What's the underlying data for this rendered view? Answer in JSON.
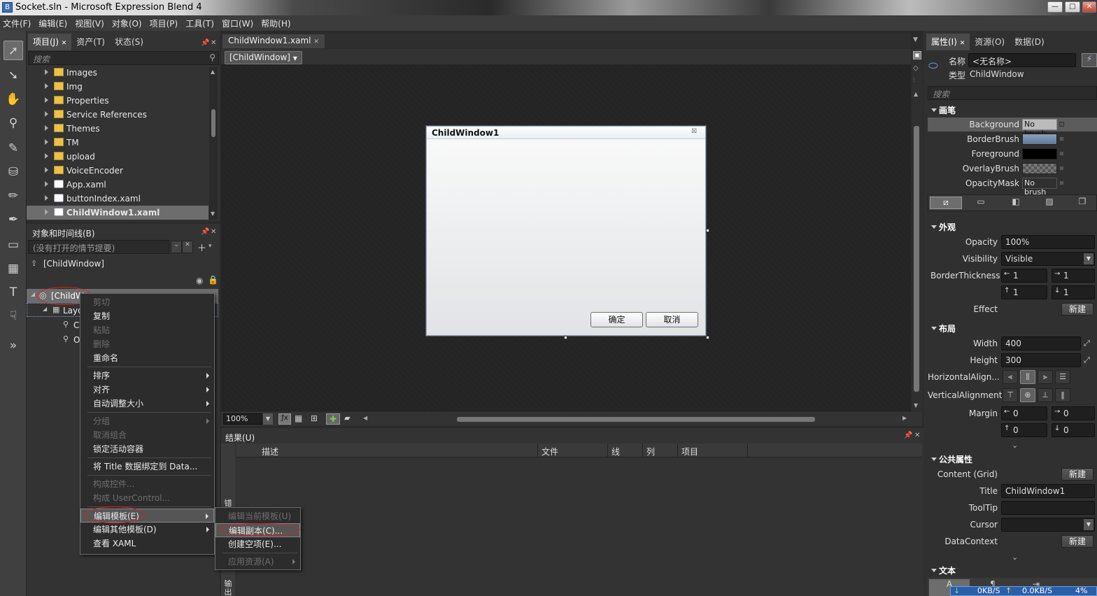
{
  "window": {
    "title": "Socket.sln - Microsoft Expression Blend 4",
    "app_icon": "blend-icon"
  },
  "menu": [
    "文件(F)",
    "编辑(E)",
    "视图(V)",
    "对象(O)",
    "项目(P)",
    "工具(T)",
    "窗口(W)",
    "帮助(H)"
  ],
  "project_panel": {
    "tabs": [
      "项目(J)",
      "资产(T)",
      "状态(S)"
    ],
    "search_placeholder": "搜索",
    "items": [
      {
        "label": "Images",
        "type": "folder"
      },
      {
        "label": "Img",
        "type": "folder"
      },
      {
        "label": "Properties",
        "type": "folder"
      },
      {
        "label": "Service References",
        "type": "folder"
      },
      {
        "label": "Themes",
        "type": "folder"
      },
      {
        "label": "TM",
        "type": "folder"
      },
      {
        "label": "upload",
        "type": "folder"
      },
      {
        "label": "VoiceEncoder",
        "type": "folder"
      },
      {
        "label": "App.xaml",
        "type": "xaml"
      },
      {
        "label": "buttonIndex.xaml",
        "type": "xaml"
      },
      {
        "label": "ChildWindow1.xaml",
        "type": "xaml"
      }
    ]
  },
  "objects_panel": {
    "title": "对象和时间线(B)",
    "storyboard": "(没有打开的情节提要)",
    "scope": "[ChildWindow]",
    "tree": [
      {
        "label": "[ChildW"
      },
      {
        "label": "Layo"
      },
      {
        "label": "C"
      },
      {
        "label": "O"
      }
    ]
  },
  "context_menu": {
    "items": [
      {
        "label": "剪切",
        "disabled": true
      },
      {
        "label": "复制",
        "disabled": false
      },
      {
        "label": "粘贴",
        "disabled": true
      },
      {
        "label": "删除",
        "disabled": true
      },
      {
        "label": "重命名",
        "disabled": false
      },
      {
        "label": "排序",
        "disabled": false,
        "submenu": true
      },
      {
        "label": "对齐",
        "disabled": false,
        "submenu": true
      },
      {
        "label": "自动调整大小",
        "disabled": false,
        "submenu": true
      },
      {
        "label": "分组",
        "disabled": true,
        "submenu": true
      },
      {
        "label": "取消组合",
        "disabled": true
      },
      {
        "label": "锁定活动容器",
        "disabled": false
      },
      {
        "label": "将 Title 数据绑定到 Data...",
        "disabled": false
      },
      {
        "label": "构成控件...",
        "disabled": true
      },
      {
        "label": "构成 UserControl...",
        "disabled": true
      },
      {
        "label": "编辑模板(E)",
        "disabled": false,
        "submenu": true
      },
      {
        "label": "编辑其他模板(D)",
        "disabled": false,
        "submenu": true
      },
      {
        "label": "查看 XAML",
        "disabled": false
      }
    ]
  },
  "template_submenu": {
    "items": [
      {
        "label": "编辑当前模板(U)",
        "disabled": true
      },
      {
        "label": "编辑副本(C)...",
        "disabled": false
      },
      {
        "label": "创建空项(E)...",
        "disabled": false
      },
      {
        "label": "应用资源(A)",
        "disabled": true
      }
    ]
  },
  "document": {
    "tab": "ChildWindow1.xaml",
    "breadcrumb": "[ChildWindow]",
    "zoom": "100%",
    "child_window": {
      "title": "ChildWindow1",
      "ok": "确定",
      "cancel": "取消"
    }
  },
  "results": {
    "title": "结果(U)",
    "columns": [
      "描述",
      "文件",
      "线",
      "列",
      "项目"
    ],
    "side_tab": "错误",
    "side_tab2": "输出"
  },
  "properties": {
    "tabs": [
      "属性(I)",
      "资源(O)",
      "数据(D)"
    ],
    "name_label": "名称",
    "name_value": "<无名称>",
    "type_label": "类型",
    "type_value": "ChildWindow",
    "search_placeholder": "搜索",
    "brushes": {
      "title": "画笔",
      "rows": [
        {
          "label": "Background",
          "value": "No brush",
          "swatch": ""
        },
        {
          "label": "BorderBrush",
          "value": "",
          "swatch": "#6f8aa6"
        },
        {
          "label": "Foreground",
          "value": "",
          "swatch": "#000000"
        },
        {
          "label": "OverlayBrush",
          "value": "",
          "swatch": "checker"
        },
        {
          "label": "OpacityMask",
          "value": "No brush",
          "swatch": ""
        }
      ]
    },
    "appearance": {
      "title": "外观",
      "opacity_label": "Opacity",
      "opacity": "100%",
      "visibility_label": "Visibility",
      "visibility": "Visible",
      "border_label": "BorderThickness",
      "border": [
        "1",
        "1",
        "1",
        "1"
      ],
      "effect_label": "Effect",
      "new": "新建"
    },
    "layout": {
      "title": "布局",
      "width_label": "Width",
      "width": "400",
      "height_label": "Height",
      "height": "300",
      "halign_label": "HorizontalAlign...",
      "valign_label": "VerticalAlignment",
      "margin_label": "Margin",
      "margin": [
        "0",
        "0",
        "0",
        "0"
      ]
    },
    "common": {
      "title": "公共属性",
      "content_label": "Content (Grid)",
      "title_label": "Title",
      "title_value": "ChildWindow1",
      "tooltip_label": "ToolTip",
      "cursor_label": "Cursor",
      "datacontext_label": "DataContext",
      "new": "新建"
    },
    "text": {
      "title": "文本"
    }
  },
  "net_overlay": {
    "down": "0KB/S",
    "up": "0.0KB/S",
    "pct": "4%"
  }
}
